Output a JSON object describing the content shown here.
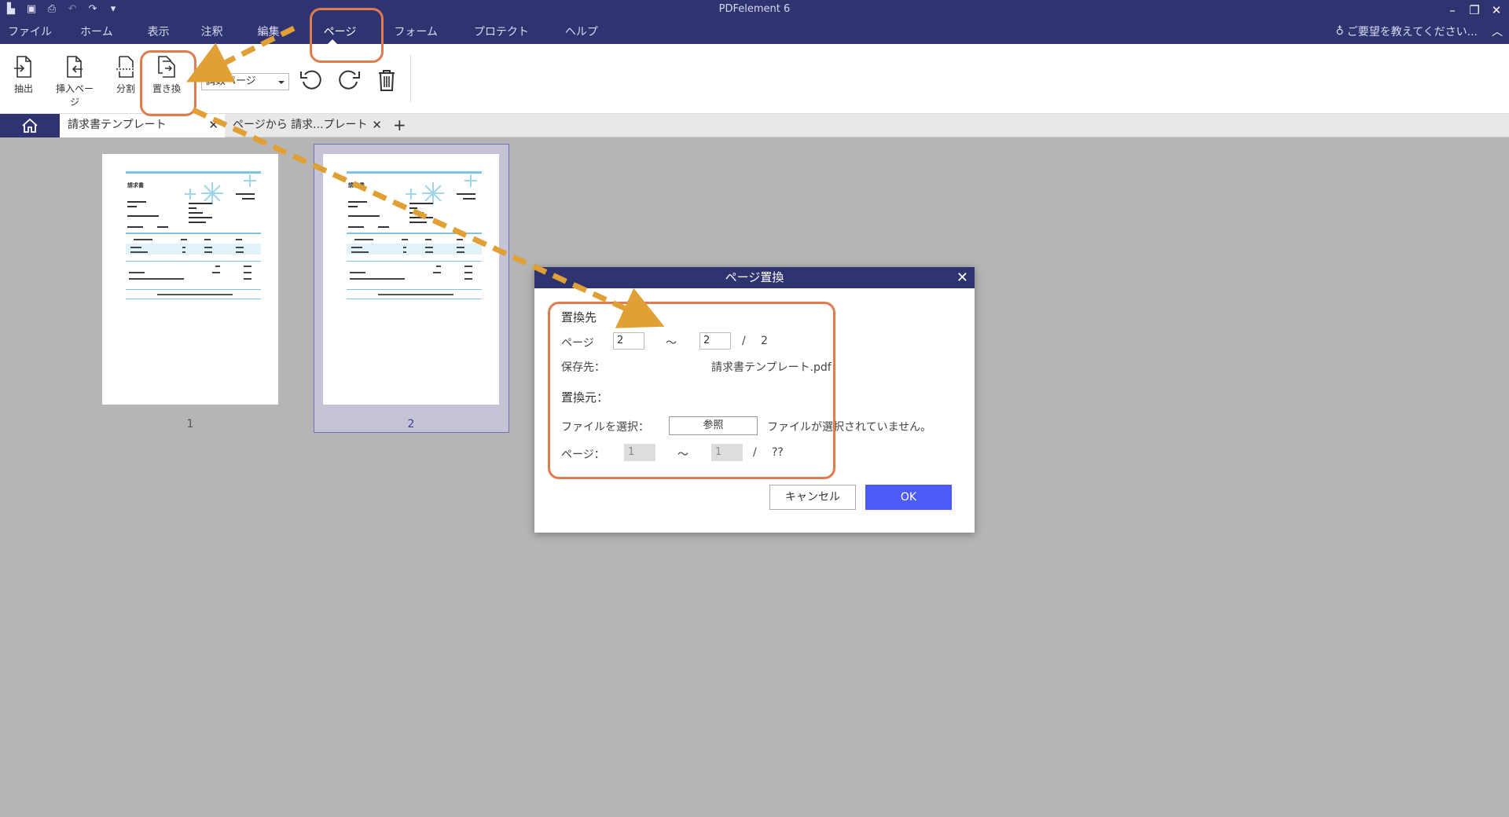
{
  "titlebar": {
    "app_title": "PDFelement 6",
    "menu": [
      "ファイル",
      "ホーム",
      "表示",
      "注釈",
      "編集",
      "ページ",
      "フォーム",
      "プロテクト",
      "ヘルプ"
    ],
    "active_menu": "ページ",
    "help_hint": "ご要望を教えてください..."
  },
  "toolbar": {
    "extract": "抽出",
    "insert": "挿入ページ",
    "split": "分割",
    "replace": "置き換",
    "page_filter": "偶数ページ"
  },
  "tabs": {
    "tab1": "請求書テンプレート",
    "tab2": "ページから 請求...プレート"
  },
  "thumbnails": [
    {
      "number": "1"
    },
    {
      "number": "2"
    }
  ],
  "invoice": {
    "title": "請求書"
  },
  "dialog": {
    "title": "ページ置換",
    "dest_heading": "置換先",
    "page_label": "ページ",
    "page_from": "2",
    "tilde": "～",
    "page_to": "2",
    "slash": "/",
    "page_total": "2",
    "save_label": "保存先：",
    "save_file": "請求書テンプレート.pdf",
    "src_heading": "置換元：",
    "file_label": "ファイルを選択：",
    "browse": "参照",
    "no_file": "ファイルが選択されていません。",
    "src_page_label": "ページ：",
    "src_from": "1",
    "src_to": "1",
    "src_total": "??",
    "cancel": "キャンセル",
    "ok": "OK"
  },
  "colors": {
    "titlebar": "#2f3370",
    "highlight": "#e07b4f",
    "arrow": "#e0a036",
    "ok_button": "#4d5bf9"
  }
}
